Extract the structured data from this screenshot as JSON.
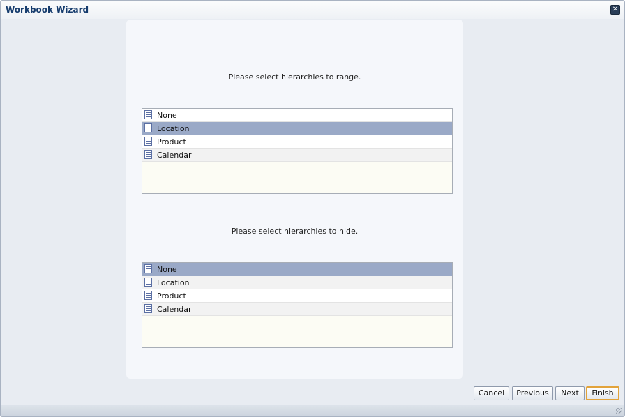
{
  "dialog": {
    "title": "Workbook Wizard",
    "close_glyph": "✕"
  },
  "range_section": {
    "prompt": "Please select hierarchies to range.",
    "items": [
      {
        "label": "None",
        "icon": "list-icon",
        "selected": false
      },
      {
        "label": "Location",
        "icon": "list-icon",
        "selected": true
      },
      {
        "label": "Product",
        "icon": "list-icon",
        "selected": false
      },
      {
        "label": "Calendar",
        "icon": "list-icon",
        "selected": false
      }
    ]
  },
  "hide_section": {
    "prompt": "Please select hierarchies to hide.",
    "items": [
      {
        "label": "None",
        "icon": "list-icon",
        "selected": true
      },
      {
        "label": "Location",
        "icon": "list-icon",
        "selected": false
      },
      {
        "label": "Product",
        "icon": "list-icon",
        "selected": false
      },
      {
        "label": "Calendar",
        "icon": "list-icon",
        "selected": false
      }
    ]
  },
  "buttons": {
    "cancel": "Cancel",
    "previous": "Previous",
    "next": "Next",
    "finish": "Finish"
  },
  "colors": {
    "selected_row": "#9aa9c7",
    "title_text": "#163c6d",
    "default_button_border": "#e2a33b"
  }
}
